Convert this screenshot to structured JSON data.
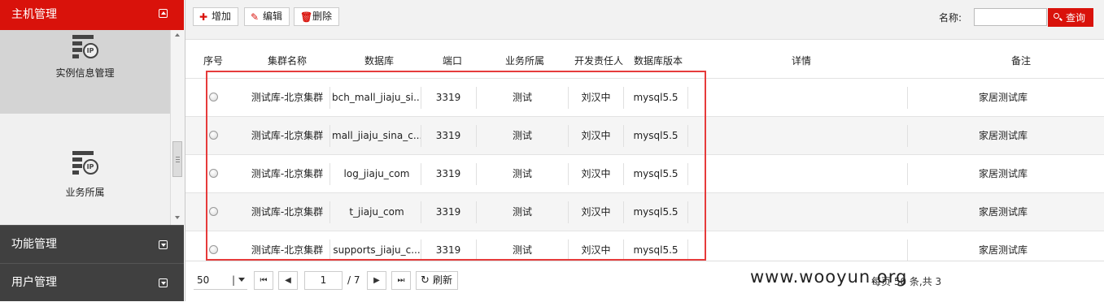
{
  "sidebar": {
    "sections": [
      {
        "label": "主机管理",
        "state": "expanded"
      },
      {
        "label": "功能管理",
        "state": "collapsed"
      },
      {
        "label": "用户管理",
        "state": "collapsed"
      }
    ],
    "tiles": [
      {
        "label": "实例信息管理",
        "icon": "ip-list-icon",
        "active": true
      },
      {
        "label": "业务所属",
        "icon": "ip-list-icon",
        "active": false
      }
    ]
  },
  "toolbar": {
    "add_label": "增加",
    "edit_label": "编辑",
    "delete_label": "删除",
    "search_label": "名称:",
    "search_value": "",
    "search_button": "查询"
  },
  "table": {
    "columns": [
      "序号",
      "集群名称",
      "数据库",
      "端口",
      "业务所属",
      "开发责任人",
      "数据库版本",
      "详情",
      "备注"
    ],
    "rows": [
      {
        "cluster": "测试库-北京集群",
        "database": "bch_mall_jiaju_si...",
        "port": "3319",
        "business": "测试",
        "owner": "刘汉中",
        "version": "mysql5.5",
        "detail": "",
        "remark": "家居测试库"
      },
      {
        "cluster": "测试库-北京集群",
        "database": "mall_jiaju_sina_c...",
        "port": "3319",
        "business": "测试",
        "owner": "刘汉中",
        "version": "mysql5.5",
        "detail": "",
        "remark": "家居测试库"
      },
      {
        "cluster": "测试库-北京集群",
        "database": "log_jiaju_com",
        "port": "3319",
        "business": "测试",
        "owner": "刘汉中",
        "version": "mysql5.5",
        "detail": "",
        "remark": "家居测试库"
      },
      {
        "cluster": "测试库-北京集群",
        "database": "t_jiaju_com",
        "port": "3319",
        "business": "测试",
        "owner": "刘汉中",
        "version": "mysql5.5",
        "detail": "",
        "remark": "家居测试库"
      },
      {
        "cluster": "测试库-北京集群",
        "database": "supports_jiaju_c...",
        "port": "3319",
        "business": "测试",
        "owner": "刘汉中",
        "version": "mysql5.5",
        "detail": "",
        "remark": "家居测试库"
      }
    ]
  },
  "pager": {
    "page_size": "50",
    "current_page": "1",
    "total_pages": "/ 7",
    "refresh_label": "刷新",
    "info": "每页 50 条,共 3"
  },
  "watermark": "www.wooyun.org",
  "colors": {
    "accent": "#d9120b",
    "dark": "#404040",
    "highlight": "#e63b3b"
  }
}
